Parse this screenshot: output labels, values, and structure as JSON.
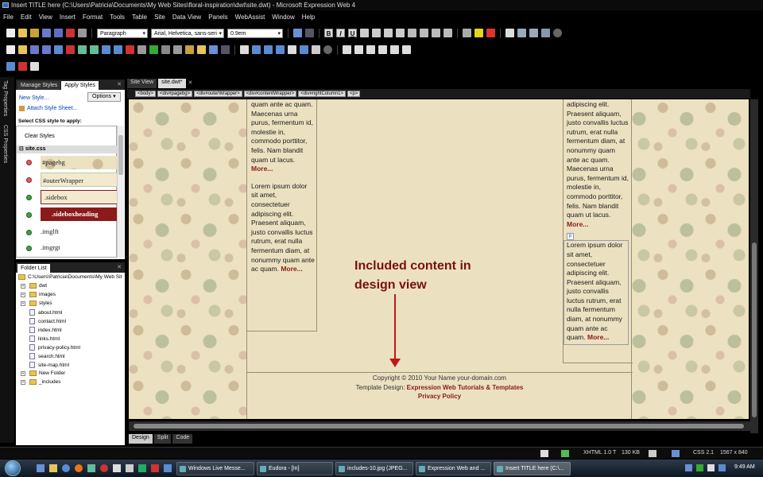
{
  "window": {
    "title": "Insert TITLE here (C:\\Users\\Patricia\\Documents\\My Web Sites\\floral-inspiration\\dwt\\site.dwt) - Microsoft Expression Web 4"
  },
  "menu": [
    "File",
    "Edit",
    "View",
    "Insert",
    "Format",
    "Tools",
    "Table",
    "Site",
    "Data View",
    "Panels",
    "WebAssist",
    "Window",
    "Help"
  ],
  "toolbar": {
    "style_select": "Paragraph",
    "font_select": "Arial, Helvetica, sans-seri",
    "size_select": "0.9em",
    "bold": "B",
    "italic": "I",
    "underline": "U"
  },
  "side_tabs": [
    "Tag Properties",
    "CSS Properties"
  ],
  "styles_panel": {
    "tabs": [
      "Manage Styles",
      "Apply Styles"
    ],
    "new_style": "New Style...",
    "options": "Options",
    "attach": "Attach Style Sheet...",
    "select_label": "Select CSS style to apply:",
    "clear": "Clear Styles",
    "sheet": "site.css",
    "styles": [
      "#pagebg",
      "#outerWrapper",
      ".sidebox",
      ".sideboxheading",
      ".imglft",
      ".imgrgt"
    ]
  },
  "folder_panel": {
    "title": "Folder List",
    "root": "C:\\Users\\Patricia\\Documents\\My Web Sites\\floral-inspiration",
    "items": [
      {
        "name": "dwt",
        "type": "folder"
      },
      {
        "name": "images",
        "type": "folder"
      },
      {
        "name": "styles",
        "type": "folder"
      },
      {
        "name": "about.html",
        "type": "file"
      },
      {
        "name": "contact.html",
        "type": "file"
      },
      {
        "name": "index.html",
        "type": "file"
      },
      {
        "name": "links.html",
        "type": "file"
      },
      {
        "name": "privacy-policy.html",
        "type": "file"
      },
      {
        "name": "search.html",
        "type": "file"
      },
      {
        "name": "site-map.html",
        "type": "file"
      },
      {
        "name": "New Folder",
        "type": "folder"
      },
      {
        "name": "_includes",
        "type": "folder"
      }
    ]
  },
  "doc_tabs": [
    "Site View",
    "site.dwt*"
  ],
  "breadcrumb": [
    "<body>",
    "<div#pagebg>",
    "<div#outerWrapper>",
    "<div#contentWrapper>",
    "<div#rightColumn1>",
    "<p>"
  ],
  "content": {
    "left_p1": "quam ante ac quam. Maecenas urna purus, fermentum id, molestie in, commodo porttitor, felis. Nam blandit quam ut lacus.",
    "left_p2": "Lorem ipsum dolor sit amet, consectetuer adipiscing elit. Praesent aliquam, justo convallis luctus rutrum, erat nulla fermentum diam, at nonummy quam ante ac quam.",
    "right_p1": "adipiscing elit. Praesent aliquam, justo convallis luctus rutrum, erat nulla fermentum diam, at nonummy quam ante ac quam. Maecenas urna purus, fermentum id, molestie in, commodo porttitor, felis. Nam blandit quam ut lacus.",
    "right_p2": "Lorem ipsum dolor sit amet, consectetuer adipiscing elit. Praesent aliquam, justo convallis luctus rutrum, erat nulla fermentum diam, at nonummy quam ante ac quam.",
    "more": "More...",
    "p_tag": "p",
    "annotation": "Included content in design view",
    "footer_copy": "Copyright © 2010 Your Name your-domain.com",
    "footer_design_label": "Template Design:",
    "footer_design_link": "Expression Web Tutorials & Templates",
    "footer_privacy": "Privacy Policy"
  },
  "view_tabs": [
    "Design",
    "Split",
    "Code"
  ],
  "statusbar": {
    "doctype": "XHTML 1.0 T",
    "size": "130 KB",
    "css": "CSS 2.1",
    "dimensions": "1567 x 840"
  },
  "taskbar": {
    "buttons": [
      "Windows Live Messe...",
      "Eudora - [In]",
      "includes-10.jpg (JPEG...",
      "Expression Web and ...",
      "Insert TITLE here (C:\\..."
    ],
    "time": "9:49 AM"
  }
}
